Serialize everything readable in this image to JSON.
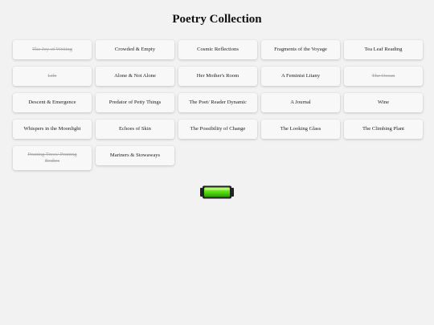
{
  "header": {
    "title": "Poetry Collection"
  },
  "poems": [
    {
      "label": "The Joy of Writing",
      "done": true
    },
    {
      "label": "Crowded & Empty",
      "done": false
    },
    {
      "label": "Cosmic Reflections",
      "done": false
    },
    {
      "label": "Fragments of the Voyage",
      "done": false
    },
    {
      "label": "Tea Leaf Reading",
      "done": false
    },
    {
      "label": "Life",
      "done": true
    },
    {
      "label": "Alone & Not Alone",
      "done": false
    },
    {
      "label": "Her Mother's Room",
      "done": false
    },
    {
      "label": "A Feminist Litany",
      "done": false
    },
    {
      "label": "The Ocean",
      "done": true
    },
    {
      "label": "Descent & Emergence",
      "done": false
    },
    {
      "label": "Predator of Petty Things",
      "done": false
    },
    {
      "label": "The Poet/ Reader Dynamic",
      "done": false
    },
    {
      "label": "A Journal",
      "done": false
    },
    {
      "label": "Wine",
      "done": false
    },
    {
      "label": "Whispers in the Moonlight",
      "done": false
    },
    {
      "label": "Echoes of Skin",
      "done": false
    },
    {
      "label": "The Possibility of Change",
      "done": false
    },
    {
      "label": "The Looking Glass",
      "done": false
    },
    {
      "label": "The Climbing Plant",
      "done": false
    },
    {
      "label": "Pruning Trees/ Pruning Bodies",
      "done": true
    },
    {
      "label": "Mariners & Stowaways",
      "done": false
    }
  ],
  "progress_indicator": {
    "icon": "battery-icon",
    "color": "#55dd11",
    "fill_fraction": 1.0
  }
}
